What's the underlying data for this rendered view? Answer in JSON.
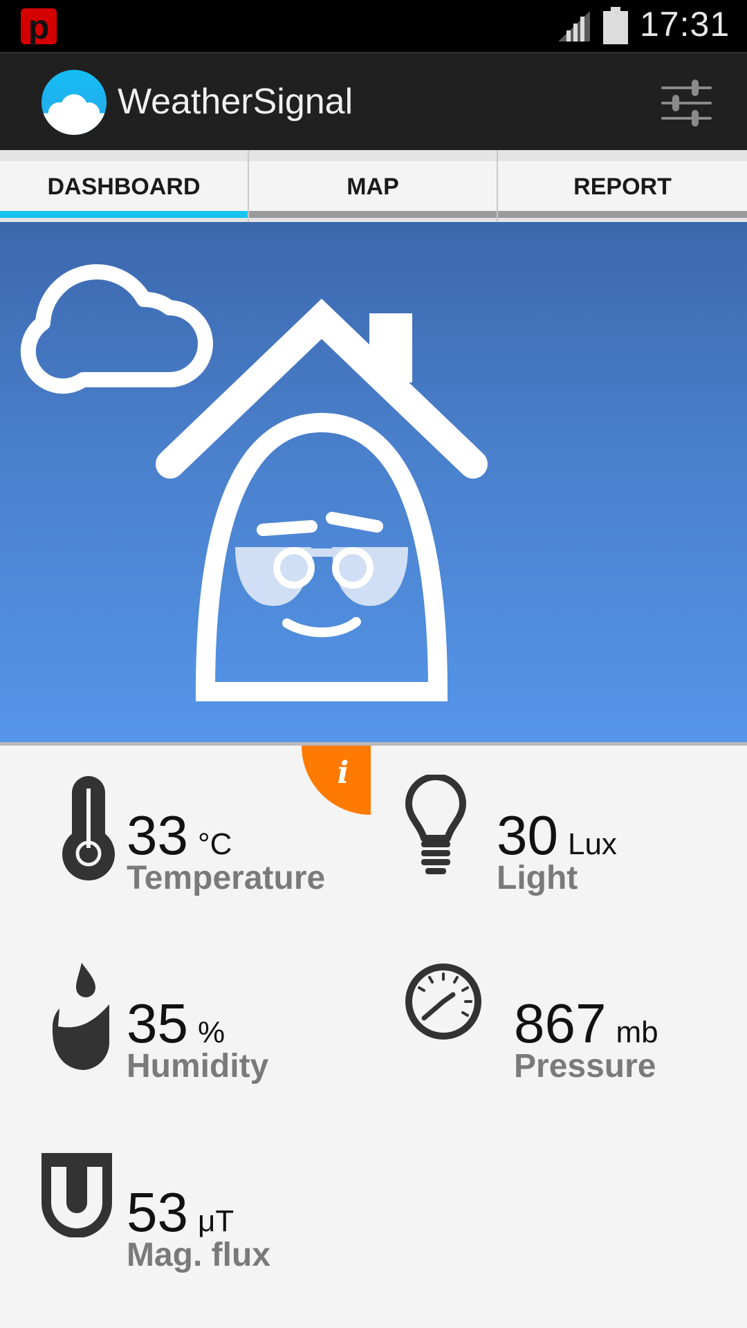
{
  "status_bar": {
    "time": "17:31",
    "notification_icon": "p",
    "icons": [
      "signal-icon",
      "battery-icon"
    ]
  },
  "app_bar": {
    "title": "WeatherSignal",
    "logo_icon": "weathersignal-logo-icon",
    "action_icon": "settings-sliders-icon"
  },
  "tabs": [
    {
      "label": "DASHBOARD",
      "active": true
    },
    {
      "label": "MAP",
      "active": false
    },
    {
      "label": "REPORT",
      "active": false
    }
  ],
  "info_badge": {
    "label": "i",
    "color": "#ff7a00"
  },
  "sensors": [
    {
      "value": "33",
      "unit": "°C",
      "label": "Temperature",
      "icon": "thermometer-icon"
    },
    {
      "value": "30",
      "unit": "Lux",
      "label": "Light",
      "icon": "lightbulb-icon"
    },
    {
      "value": "35",
      "unit": "%",
      "label": "Humidity",
      "icon": "humidity-drop-icon"
    },
    {
      "value": "867",
      "unit": "mb",
      "label": "Pressure",
      "icon": "pressure-gauge-icon"
    },
    {
      "value": "53",
      "unit": "μT",
      "label": "Mag. flux",
      "icon": "magnet-icon"
    }
  ],
  "colors": {
    "tab_active": "#17c4f0",
    "app_bar": "#202020",
    "hero_top": "#3c68ad",
    "hero_bottom": "#5595e8"
  }
}
